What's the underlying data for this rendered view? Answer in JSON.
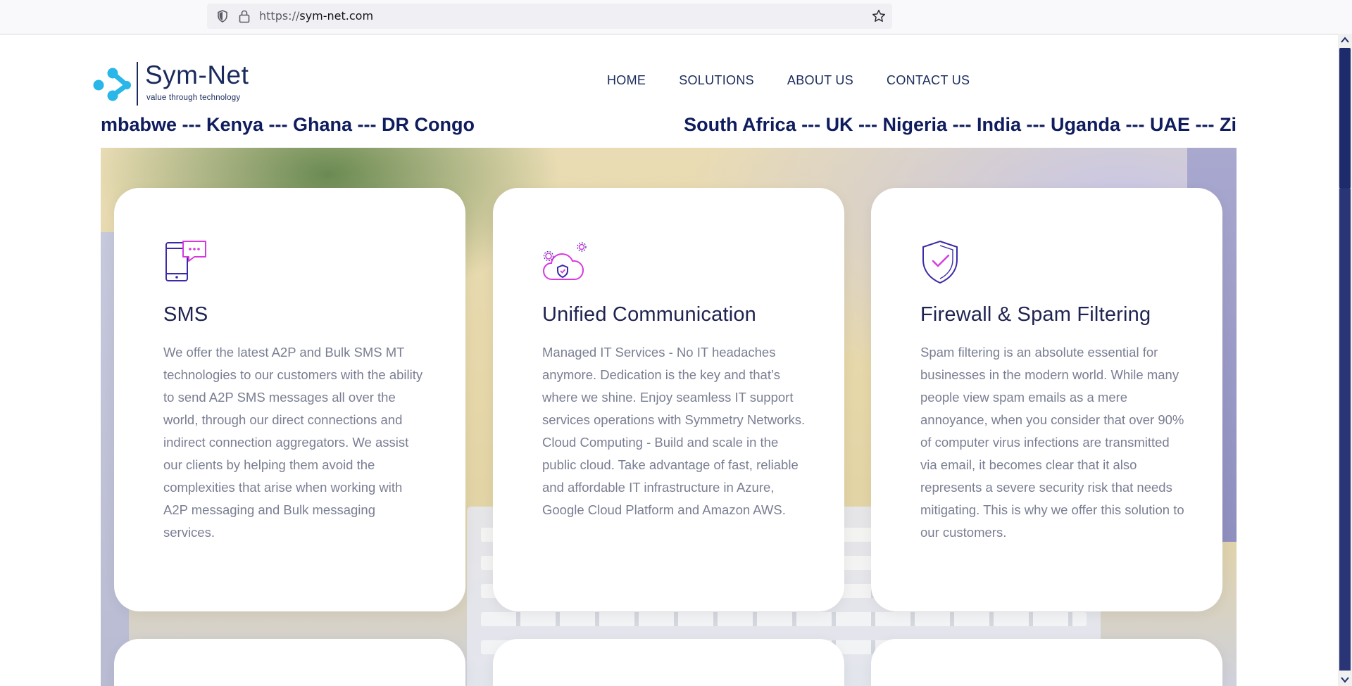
{
  "browser": {
    "url_scheme": "https://",
    "url_host": "sym-net.com"
  },
  "header": {
    "brand": "Sym-Net",
    "tagline": "value through technology",
    "nav": [
      {
        "label": "HOME"
      },
      {
        "label": "SOLUTIONS"
      },
      {
        "label": "ABOUT US"
      },
      {
        "label": "CONTACT US"
      }
    ]
  },
  "ticker": {
    "left_text": "mbabwe --- Kenya --- Ghana --- DR Congo",
    "right_text": "South Africa --- UK --- Nigeria --- India --- Uganda --- UAE --- Zi"
  },
  "cards": [
    {
      "icon": "mobile-chat-icon",
      "title": "SMS",
      "body": "We offer the latest A2P and Bulk SMS MT technologies to our customers with the ability to send A2P SMS messages all over the world, through our direct connections and indirect connection aggregators. We assist our clients by helping them avoid the complexities that arise when working with A2P messaging and Bulk messaging services."
    },
    {
      "icon": "cloud-shield-icon",
      "title": "Unified Communication",
      "body": "Managed IT Services - No IT headaches anymore. Dedication is the key and that’s where we shine. Enjoy seamless IT support services operations with Symmetry Networks. Cloud Computing - Build and scale in the public cloud. Take advantage of fast, reliable and affordable IT infrastructure in Azure, Google Cloud Platform and Amazon AWS."
    },
    {
      "icon": "shield-check-icon",
      "title": "Firewall & Spam Filtering",
      "body": "Spam filtering is an absolute essential for businesses in the modern world. While many people view spam emails as a mere annoyance, when you consider that over 90% of computer virus infections are transmitted via email, it becomes clear that it also represents a severe security risk that needs mitigating. This is why we offer this solution to our customers."
    }
  ],
  "colors": {
    "brand_navy": "#1a2a5c",
    "accent_cyan": "#29b6e8",
    "icon_purple": "#3b2ba8",
    "icon_magenta": "#d63adf"
  }
}
